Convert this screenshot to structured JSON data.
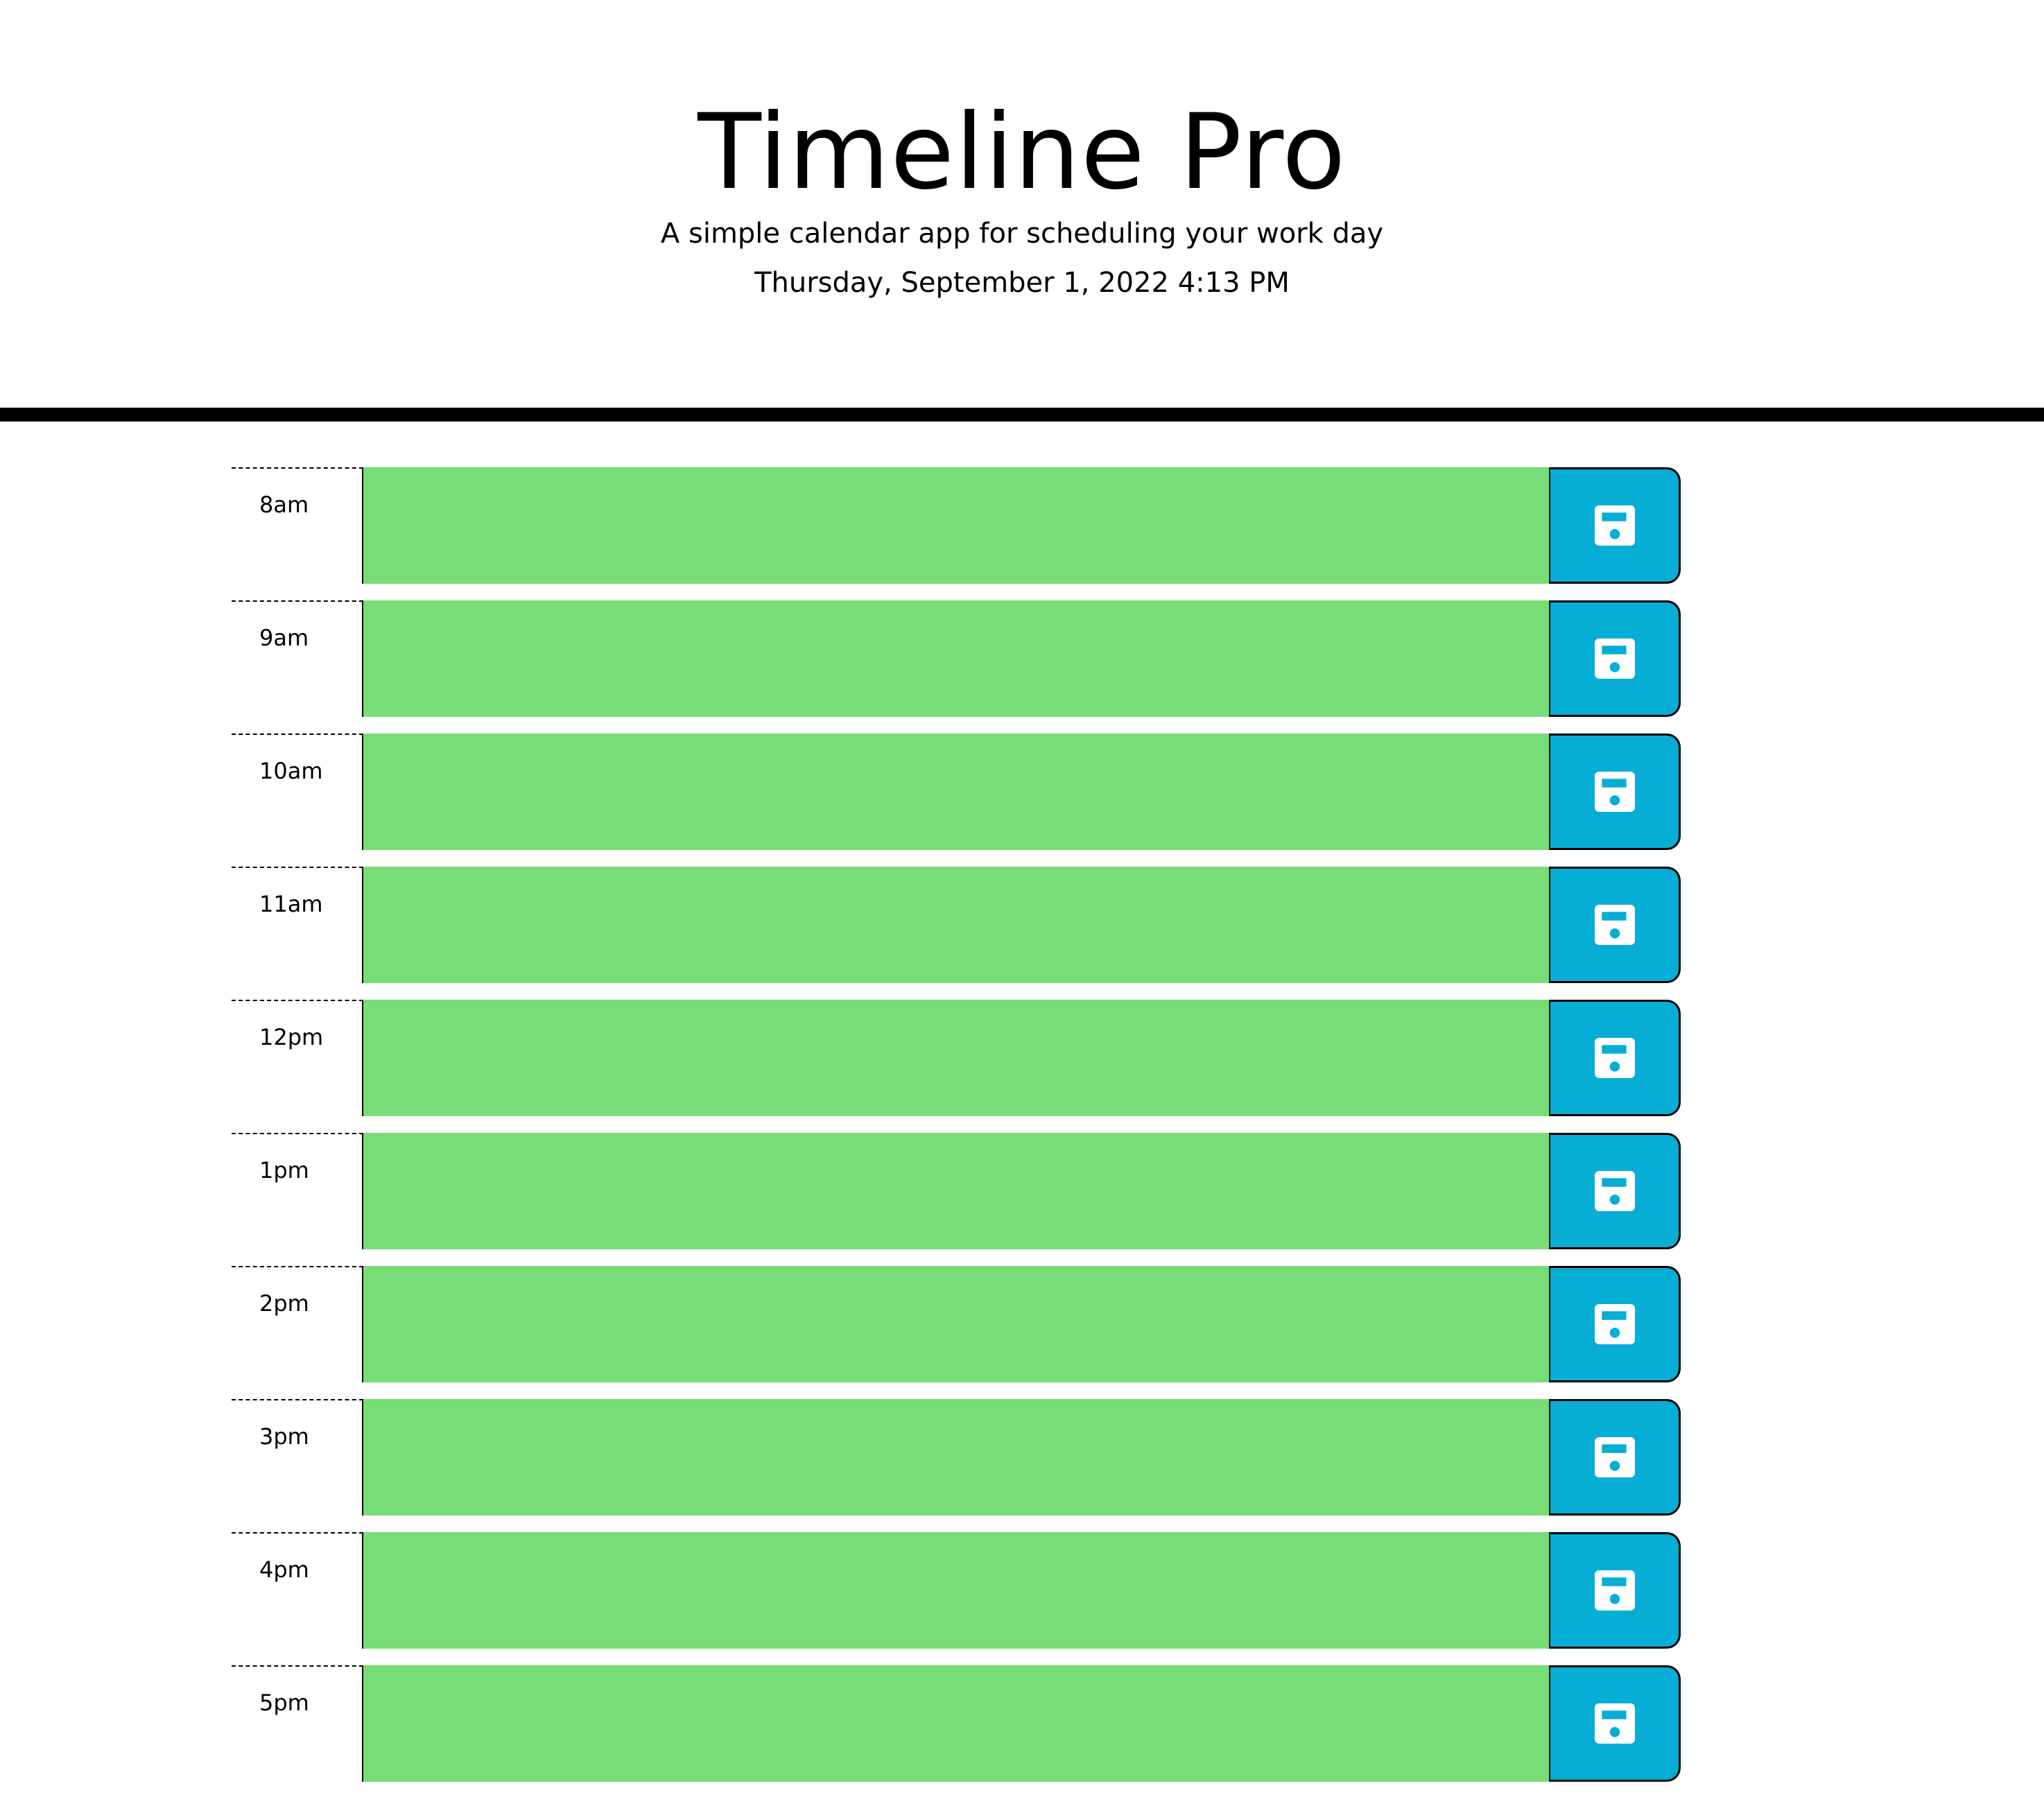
{
  "header": {
    "title": "Timeline Pro",
    "subtitle": "A simple calendar app for scheduling your work day",
    "current_datetime": "Thursday, September 1, 2022 4:13 PM"
  },
  "colors": {
    "future_block": "#77dd77",
    "save_button": "#06aed5",
    "divider": "#000000"
  },
  "timeblocks": [
    {
      "hour": "8am",
      "text": "",
      "save_icon": "floppy-disk-icon"
    },
    {
      "hour": "9am",
      "text": "",
      "save_icon": "floppy-disk-icon"
    },
    {
      "hour": "10am",
      "text": "",
      "save_icon": "floppy-disk-icon"
    },
    {
      "hour": "11am",
      "text": "",
      "save_icon": "floppy-disk-icon"
    },
    {
      "hour": "12pm",
      "text": "",
      "save_icon": "floppy-disk-icon"
    },
    {
      "hour": "1pm",
      "text": "",
      "save_icon": "floppy-disk-icon"
    },
    {
      "hour": "2pm",
      "text": "",
      "save_icon": "floppy-disk-icon"
    },
    {
      "hour": "3pm",
      "text": "",
      "save_icon": "floppy-disk-icon"
    },
    {
      "hour": "4pm",
      "text": "",
      "save_icon": "floppy-disk-icon"
    },
    {
      "hour": "5pm",
      "text": "",
      "save_icon": "floppy-disk-icon"
    }
  ]
}
